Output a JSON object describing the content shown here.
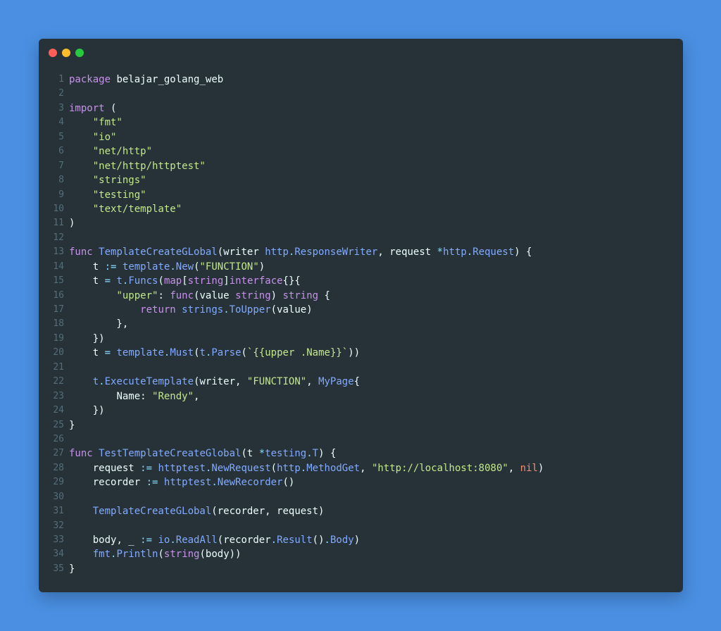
{
  "window": {
    "controls": [
      "close",
      "minimize",
      "maximize"
    ],
    "colors": {
      "close": "#ff5f56",
      "minimize": "#ffbd2e",
      "maximize": "#27c93f",
      "background": "#263238",
      "page": "#4a8fe2"
    }
  },
  "code": {
    "language": "go",
    "lines": [
      {
        "n": "1",
        "tokens": [
          [
            "kw",
            "package"
          ],
          [
            "pn",
            " "
          ],
          [
            "id",
            "belajar_golang_web"
          ]
        ]
      },
      {
        "n": "2",
        "tokens": []
      },
      {
        "n": "3",
        "tokens": [
          [
            "kw",
            "import"
          ],
          [
            "pn",
            " ("
          ]
        ]
      },
      {
        "n": "4",
        "tokens": [
          [
            "pn",
            "    "
          ],
          [
            "str",
            "\"fmt\""
          ]
        ]
      },
      {
        "n": "5",
        "tokens": [
          [
            "pn",
            "    "
          ],
          [
            "str",
            "\"io\""
          ]
        ]
      },
      {
        "n": "6",
        "tokens": [
          [
            "pn",
            "    "
          ],
          [
            "str",
            "\"net/http\""
          ]
        ]
      },
      {
        "n": "7",
        "tokens": [
          [
            "pn",
            "    "
          ],
          [
            "str",
            "\"net/http/httptest\""
          ]
        ]
      },
      {
        "n": "8",
        "tokens": [
          [
            "pn",
            "    "
          ],
          [
            "str",
            "\"strings\""
          ]
        ]
      },
      {
        "n": "9",
        "tokens": [
          [
            "pn",
            "    "
          ],
          [
            "str",
            "\"testing\""
          ]
        ]
      },
      {
        "n": "10",
        "tokens": [
          [
            "pn",
            "    "
          ],
          [
            "str",
            "\"text/template\""
          ]
        ]
      },
      {
        "n": "11",
        "tokens": [
          [
            "pn",
            ")"
          ]
        ]
      },
      {
        "n": "12",
        "tokens": []
      },
      {
        "n": "13",
        "tokens": [
          [
            "kw",
            "func"
          ],
          [
            "pn",
            " "
          ],
          [
            "fn",
            "TemplateCreateGLobal"
          ],
          [
            "pn",
            "("
          ],
          [
            "prm",
            "writer"
          ],
          [
            "pn",
            " "
          ],
          [
            "typ",
            "http"
          ],
          [
            "op",
            "."
          ],
          [
            "typ",
            "ResponseWriter"
          ],
          [
            "pn",
            ", "
          ],
          [
            "prm",
            "request"
          ],
          [
            "pn",
            " "
          ],
          [
            "op",
            "*"
          ],
          [
            "typ",
            "http"
          ],
          [
            "op",
            "."
          ],
          [
            "typ",
            "Request"
          ],
          [
            "pn",
            ") {"
          ]
        ]
      },
      {
        "n": "14",
        "tokens": [
          [
            "pn",
            "    "
          ],
          [
            "id",
            "t"
          ],
          [
            "pn",
            " "
          ],
          [
            "op",
            ":="
          ],
          [
            "pn",
            " "
          ],
          [
            "fn",
            "template"
          ],
          [
            "op",
            "."
          ],
          [
            "fn",
            "New"
          ],
          [
            "pn",
            "("
          ],
          [
            "str",
            "\"FUNCTION\""
          ],
          [
            "pn",
            ")"
          ]
        ]
      },
      {
        "n": "15",
        "tokens": [
          [
            "pn",
            "    "
          ],
          [
            "id",
            "t"
          ],
          [
            "pn",
            " "
          ],
          [
            "op",
            "="
          ],
          [
            "pn",
            " "
          ],
          [
            "fn",
            "t"
          ],
          [
            "op",
            "."
          ],
          [
            "fn",
            "Funcs"
          ],
          [
            "pn",
            "("
          ],
          [
            "kw",
            "map"
          ],
          [
            "pn",
            "["
          ],
          [
            "kw",
            "string"
          ],
          [
            "pn",
            "]"
          ],
          [
            "kw",
            "interface"
          ],
          [
            "pn",
            "{}{"
          ]
        ]
      },
      {
        "n": "16",
        "tokens": [
          [
            "pn",
            "        "
          ],
          [
            "str",
            "\"upper\""
          ],
          [
            "pn",
            ": "
          ],
          [
            "kw",
            "func"
          ],
          [
            "pn",
            "("
          ],
          [
            "prm",
            "value"
          ],
          [
            "pn",
            " "
          ],
          [
            "kw",
            "string"
          ],
          [
            "pn",
            ") "
          ],
          [
            "kw",
            "string"
          ],
          [
            "pn",
            " {"
          ]
        ]
      },
      {
        "n": "17",
        "tokens": [
          [
            "pn",
            "            "
          ],
          [
            "kw",
            "return"
          ],
          [
            "pn",
            " "
          ],
          [
            "fn",
            "strings"
          ],
          [
            "op",
            "."
          ],
          [
            "fn",
            "ToUpper"
          ],
          [
            "pn",
            "("
          ],
          [
            "prm",
            "value"
          ],
          [
            "pn",
            ")"
          ]
        ]
      },
      {
        "n": "18",
        "tokens": [
          [
            "pn",
            "        },"
          ]
        ]
      },
      {
        "n": "19",
        "tokens": [
          [
            "pn",
            "    })"
          ]
        ]
      },
      {
        "n": "20",
        "tokens": [
          [
            "pn",
            "    "
          ],
          [
            "id",
            "t"
          ],
          [
            "pn",
            " "
          ],
          [
            "op",
            "="
          ],
          [
            "pn",
            " "
          ],
          [
            "fn",
            "template"
          ],
          [
            "op",
            "."
          ],
          [
            "fn",
            "Must"
          ],
          [
            "pn",
            "("
          ],
          [
            "fn",
            "t"
          ],
          [
            "op",
            "."
          ],
          [
            "fn",
            "Parse"
          ],
          [
            "pn",
            "("
          ],
          [
            "str",
            "`{{upper .Name}}`"
          ],
          [
            "pn",
            "))"
          ]
        ]
      },
      {
        "n": "21",
        "tokens": []
      },
      {
        "n": "22",
        "tokens": [
          [
            "pn",
            "    "
          ],
          [
            "fn",
            "t"
          ],
          [
            "op",
            "."
          ],
          [
            "fn",
            "ExecuteTemplate"
          ],
          [
            "pn",
            "("
          ],
          [
            "prm",
            "writer"
          ],
          [
            "pn",
            ", "
          ],
          [
            "str",
            "\"FUNCTION\""
          ],
          [
            "pn",
            ", "
          ],
          [
            "typ",
            "MyPage"
          ],
          [
            "pn",
            "{"
          ]
        ]
      },
      {
        "n": "23",
        "tokens": [
          [
            "pn",
            "        "
          ],
          [
            "id",
            "Name"
          ],
          [
            "pn",
            ": "
          ],
          [
            "str",
            "\"Rendy\""
          ],
          [
            "pn",
            ","
          ]
        ]
      },
      {
        "n": "24",
        "tokens": [
          [
            "pn",
            "    })"
          ]
        ]
      },
      {
        "n": "25",
        "tokens": [
          [
            "pn",
            "}"
          ]
        ]
      },
      {
        "n": "26",
        "tokens": []
      },
      {
        "n": "27",
        "tokens": [
          [
            "kw",
            "func"
          ],
          [
            "pn",
            " "
          ],
          [
            "fn",
            "TestTemplateCreateGlobal"
          ],
          [
            "pn",
            "("
          ],
          [
            "prm",
            "t"
          ],
          [
            "pn",
            " "
          ],
          [
            "op",
            "*"
          ],
          [
            "typ",
            "testing"
          ],
          [
            "op",
            "."
          ],
          [
            "typ",
            "T"
          ],
          [
            "pn",
            ") {"
          ]
        ]
      },
      {
        "n": "28",
        "tokens": [
          [
            "pn",
            "    "
          ],
          [
            "id",
            "request"
          ],
          [
            "pn",
            " "
          ],
          [
            "op",
            ":="
          ],
          [
            "pn",
            " "
          ],
          [
            "fn",
            "httptest"
          ],
          [
            "op",
            "."
          ],
          [
            "fn",
            "NewRequest"
          ],
          [
            "pn",
            "("
          ],
          [
            "fn",
            "http"
          ],
          [
            "op",
            "."
          ],
          [
            "fn",
            "MethodGet"
          ],
          [
            "pn",
            ", "
          ],
          [
            "str",
            "\"http://localhost:8080\""
          ],
          [
            "pn",
            ", "
          ],
          [
            "nil",
            "nil"
          ],
          [
            "pn",
            ")"
          ]
        ]
      },
      {
        "n": "29",
        "tokens": [
          [
            "pn",
            "    "
          ],
          [
            "id",
            "recorder"
          ],
          [
            "pn",
            " "
          ],
          [
            "op",
            ":="
          ],
          [
            "pn",
            " "
          ],
          [
            "fn",
            "httptest"
          ],
          [
            "op",
            "."
          ],
          [
            "fn",
            "NewRecorder"
          ],
          [
            "pn",
            "()"
          ]
        ]
      },
      {
        "n": "30",
        "tokens": []
      },
      {
        "n": "31",
        "tokens": [
          [
            "pn",
            "    "
          ],
          [
            "fn",
            "TemplateCreateGLobal"
          ],
          [
            "pn",
            "("
          ],
          [
            "prm",
            "recorder"
          ],
          [
            "pn",
            ", "
          ],
          [
            "prm",
            "request"
          ],
          [
            "pn",
            ")"
          ]
        ]
      },
      {
        "n": "32",
        "tokens": []
      },
      {
        "n": "33",
        "tokens": [
          [
            "pn",
            "    "
          ],
          [
            "id",
            "body"
          ],
          [
            "pn",
            ", "
          ],
          [
            "id",
            "_"
          ],
          [
            "pn",
            " "
          ],
          [
            "op",
            ":="
          ],
          [
            "pn",
            " "
          ],
          [
            "fn",
            "io"
          ],
          [
            "op",
            "."
          ],
          [
            "fn",
            "ReadAll"
          ],
          [
            "pn",
            "("
          ],
          [
            "prm",
            "recorder"
          ],
          [
            "op",
            "."
          ],
          [
            "fn",
            "Result"
          ],
          [
            "pn",
            "()"
          ],
          [
            "op",
            "."
          ],
          [
            "fn",
            "Body"
          ],
          [
            "pn",
            ")"
          ]
        ]
      },
      {
        "n": "34",
        "tokens": [
          [
            "pn",
            "    "
          ],
          [
            "fn",
            "fmt"
          ],
          [
            "op",
            "."
          ],
          [
            "fn",
            "Println"
          ],
          [
            "pn",
            "("
          ],
          [
            "kw",
            "string"
          ],
          [
            "pn",
            "("
          ],
          [
            "prm",
            "body"
          ],
          [
            "pn",
            "))"
          ]
        ]
      },
      {
        "n": "35",
        "tokens": [
          [
            "pn",
            "}"
          ]
        ]
      }
    ]
  }
}
